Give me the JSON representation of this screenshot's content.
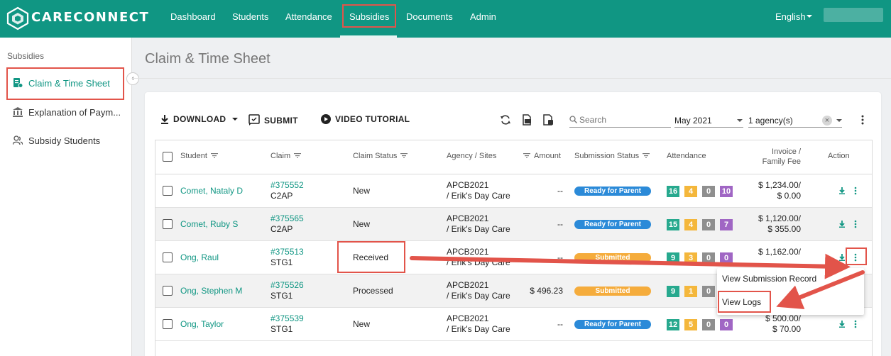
{
  "brand": {
    "name": "CARECONNECT"
  },
  "nav": {
    "items": [
      "Dashboard",
      "Students",
      "Attendance",
      "Subsidies",
      "Documents",
      "Admin"
    ],
    "active": "Subsidies",
    "language": "English"
  },
  "sidebar": {
    "title": "Subsidies",
    "items": [
      {
        "label": "Claim & Time Sheet",
        "icon": "claim-icon",
        "active": true
      },
      {
        "label": "Explanation of Paym...",
        "icon": "bank-icon",
        "active": false
      },
      {
        "label": "Subsidy Students",
        "icon": "users-icon",
        "active": false
      }
    ]
  },
  "page": {
    "title": "Claim & Time Sheet"
  },
  "toolbar": {
    "download": "DOWNLOAD",
    "submit": "SUBMIT",
    "video": "VIDEO TUTORIAL",
    "search_placeholder": "Search",
    "month": "May 2021",
    "agency": "1 agency(s)"
  },
  "table": {
    "headers": {
      "student": "Student",
      "claim": "Claim",
      "claim_status": "Claim Status",
      "agency": "Agency / Sites",
      "amount": "Amount",
      "submission_status": "Submission Status",
      "attendance": "Attendance",
      "invoice_line1": "Invoice /",
      "invoice_line2": "Family Fee",
      "action": "Action"
    },
    "rows": [
      {
        "student": "Comet, Nataly D",
        "claim_id": "#375552",
        "claim_code": "C2AP",
        "claim_status": "New",
        "agency": "APCB2021",
        "site": "/ Erik's Day Care",
        "amount": "--",
        "submission": "Ready for Parent",
        "attendance": [
          "16",
          "4",
          "0",
          "10"
        ],
        "invoice": "$ 1,234.00/",
        "fee": "$ 0.00"
      },
      {
        "student": "Comet, Ruby S",
        "claim_id": "#375565",
        "claim_code": "C2AP",
        "claim_status": "New",
        "agency": "APCB2021",
        "site": "/ Erik's Day Care",
        "amount": "--",
        "submission": "Ready for Parent",
        "attendance": [
          "15",
          "4",
          "0",
          "7"
        ],
        "invoice": "$ 1,120.00/",
        "fee": "$ 355.00"
      },
      {
        "student": "Ong, Raul",
        "claim_id": "#375513",
        "claim_code": "STG1",
        "claim_status": "Received",
        "agency": "APCB2021",
        "site": "/ Erik's Day Care",
        "amount": "--",
        "submission": "Submitted",
        "attendance": [
          "9",
          "3",
          "0",
          "0"
        ],
        "invoice": "$ 1,162.00/",
        "fee": ""
      },
      {
        "student": "Ong, Stephen M",
        "claim_id": "#375526",
        "claim_code": "STG1",
        "claim_status": "Processed",
        "agency": "APCB2021",
        "site": "/ Erik's Day Care",
        "amount": "$ 496.23",
        "submission": "Submitted",
        "attendance": [
          "9",
          "1",
          "0",
          ""
        ],
        "invoice": "",
        "fee": ""
      },
      {
        "student": "Ong, Taylor",
        "claim_id": "#375539",
        "claim_code": "STG1",
        "claim_status": "New",
        "agency": "APCB2021",
        "site": "/ Erik's Day Care",
        "amount": "--",
        "submission": "Ready for Parent",
        "attendance": [
          "12",
          "5",
          "0",
          "0"
        ],
        "invoice": "$ 500.00/",
        "fee": "$ 70.00"
      }
    ]
  },
  "menu": {
    "items": [
      "View Submission Record",
      "View Logs"
    ]
  },
  "colors": {
    "primary": "#109683",
    "highlight": "#e2544a",
    "ready": "#2b8ad8",
    "submitted": "#f5ac3c"
  }
}
